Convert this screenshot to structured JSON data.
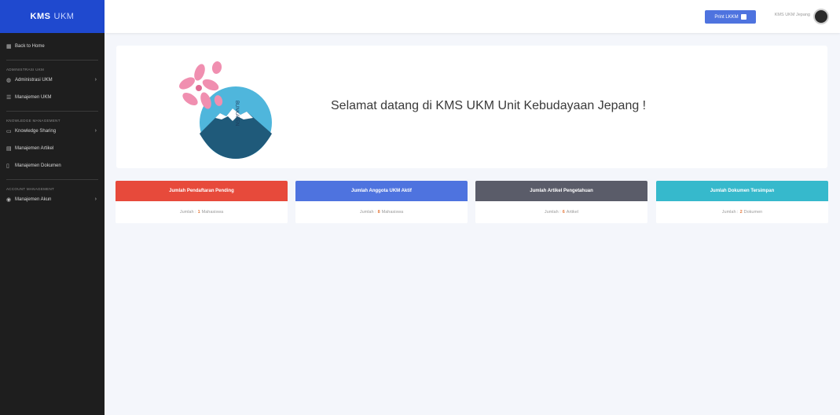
{
  "brand": {
    "name_a": "KMS",
    "name_b": "UKM"
  },
  "sidebar": {
    "items": [
      {
        "label": "Back to Home"
      }
    ],
    "heading_1": "ADMINISTRASI UKM",
    "admin_items": [
      {
        "label": "Administrasi UKM"
      },
      {
        "label": "Manajemen UKM"
      }
    ],
    "heading_2": "KNOWLEDGE MANAGEMENT",
    "km_items": [
      {
        "label": "Knowledge Sharing"
      },
      {
        "label": "Manajemen Artikel"
      },
      {
        "label": "Manajemen Dokumen"
      }
    ],
    "heading_3": "ACCOUNT MANAGEMENT",
    "account_items": [
      {
        "label": "Manajemen Akun"
      }
    ]
  },
  "topbar": {
    "print_label": "Print LKKM",
    "user_name": "KMS UKM Jepang"
  },
  "welcome": {
    "text": "Selamat datang di KMS UKM Unit Kebudayaan Jepang !",
    "logo_text": "BUNKATEN"
  },
  "stats": [
    {
      "title": "Jumlah Pendaftaran Pending",
      "prefix": "Jumlah :",
      "value": "1",
      "unit": "Mahasiswa",
      "color": "#e74a3b"
    },
    {
      "title": "Jumlah Anggota UKM Aktif",
      "prefix": "Jumlah :",
      "value": "8",
      "unit": "Mahasiswa",
      "color": "#4e73df"
    },
    {
      "title": "Jumlah Artikel Pengetahuan",
      "prefix": "Jumlah :",
      "value": "6",
      "unit": "Artikel",
      "color": "#5a5c69"
    },
    {
      "title": "Jumlah Dokumen Tersimpan",
      "prefix": "Jumlah :",
      "value": "2",
      "unit": "Dokumen",
      "color": "#36b9cc"
    }
  ],
  "colors": {
    "sidebar_bg": "#1e1e1e",
    "brand_bg": "#1f49cf",
    "page_bg": "#f4f6fb"
  }
}
